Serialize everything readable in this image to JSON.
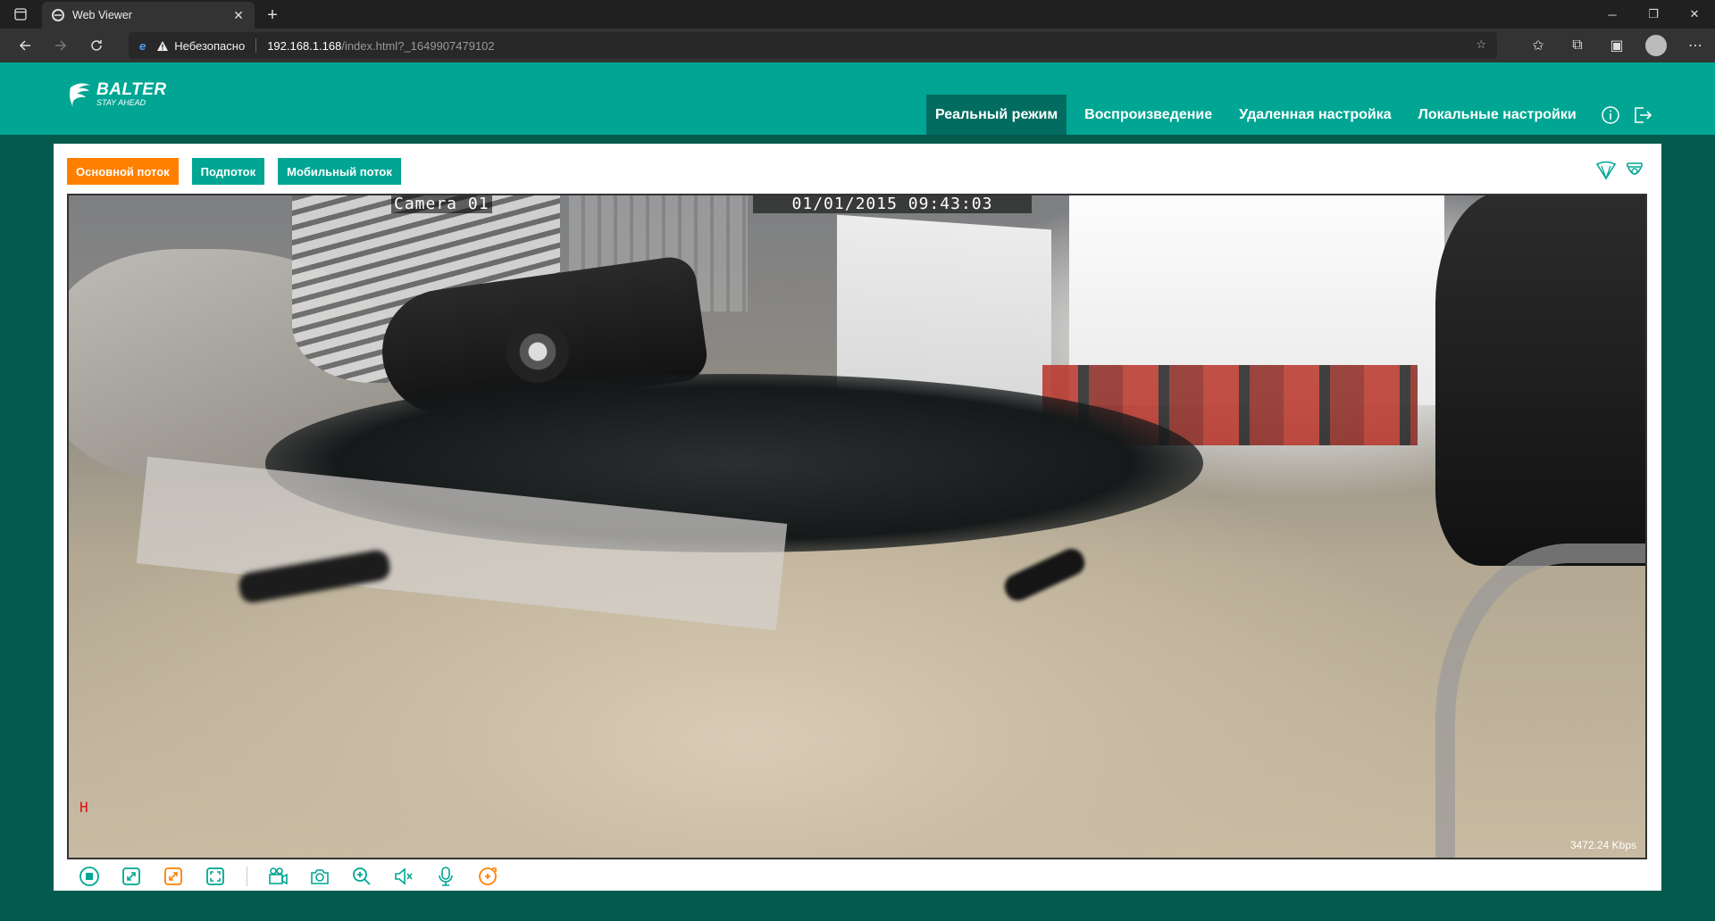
{
  "browser": {
    "tab_title": "Web Viewer",
    "address": {
      "security_label": "Небезопасно",
      "host": "192.168.1.168",
      "path": "/index.html?_1649907479102"
    }
  },
  "app": {
    "logo": {
      "name": "BALTER",
      "tagline": "STAY AHEAD"
    },
    "menu": [
      {
        "label": "Реальный режим",
        "active": true
      },
      {
        "label": "Воспроизведение",
        "active": false
      },
      {
        "label": "Удаленная настройка",
        "active": false
      },
      {
        "label": "Локальные настройки",
        "active": false
      }
    ],
    "streams": {
      "main": "Основной поток",
      "sub": "Подпоток",
      "mobile": "Мобильный поток"
    },
    "video": {
      "camera_name": "Camera 01",
      "timestamp": "01/01/2015 09:43:03",
      "marker": "H",
      "bitrate": "3472.24 Kbps"
    },
    "colors": {
      "header": "#00a693",
      "active_menu": "#036c60",
      "background": "#055a4e",
      "main_stream_button": "#ff8000",
      "accent": "#00a693",
      "toolbar_icon_orange": "#ff8000"
    },
    "toolbar_icons": [
      "stop-icon",
      "shrink-icon",
      "expand-icon",
      "fullscreen-icon",
      "record-icon",
      "snapshot-icon",
      "zoom-icon",
      "mute-icon",
      "microphone-icon",
      "ptz-icon"
    ]
  }
}
